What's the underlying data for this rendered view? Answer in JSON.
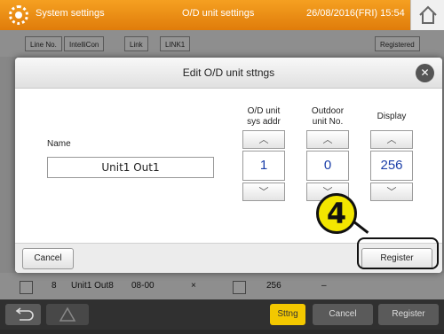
{
  "topbar": {
    "system_settings": "System settings",
    "od_unit_settings": "O/D unit settings",
    "datetime": "26/08/2016(FRI) 15:54"
  },
  "background": {
    "line_no": "Line No.",
    "intellicon": "IntelliCon",
    "link": "Link",
    "link1": "LINK1",
    "registered": "Registered",
    "row": {
      "num": "8",
      "name": "Unit1 Out8",
      "addr": "08-00",
      "mark": "×",
      "display": "256",
      "dash": "–"
    }
  },
  "bottombar": {
    "sttng": "Sttng",
    "cancel": "Cancel",
    "register": "Register"
  },
  "dialog": {
    "title": "Edit O/D unit sttngs",
    "name_label": "Name",
    "name_value": "Unit1 Out1",
    "columns": [
      {
        "label_line1": "O/D unit",
        "label_line2": "sys addr",
        "value": "1"
      },
      {
        "label_line1": "Outdoor",
        "label_line2": "unit No.",
        "value": "0"
      },
      {
        "label_line1": "Display",
        "label_line2": "",
        "value": "256"
      }
    ],
    "cancel": "Cancel",
    "register": "Register"
  },
  "callout": {
    "number": "4"
  },
  "colors": {
    "accent": "#f5a021",
    "value_text": "#1a3ea8",
    "callout": "#f3e600"
  }
}
